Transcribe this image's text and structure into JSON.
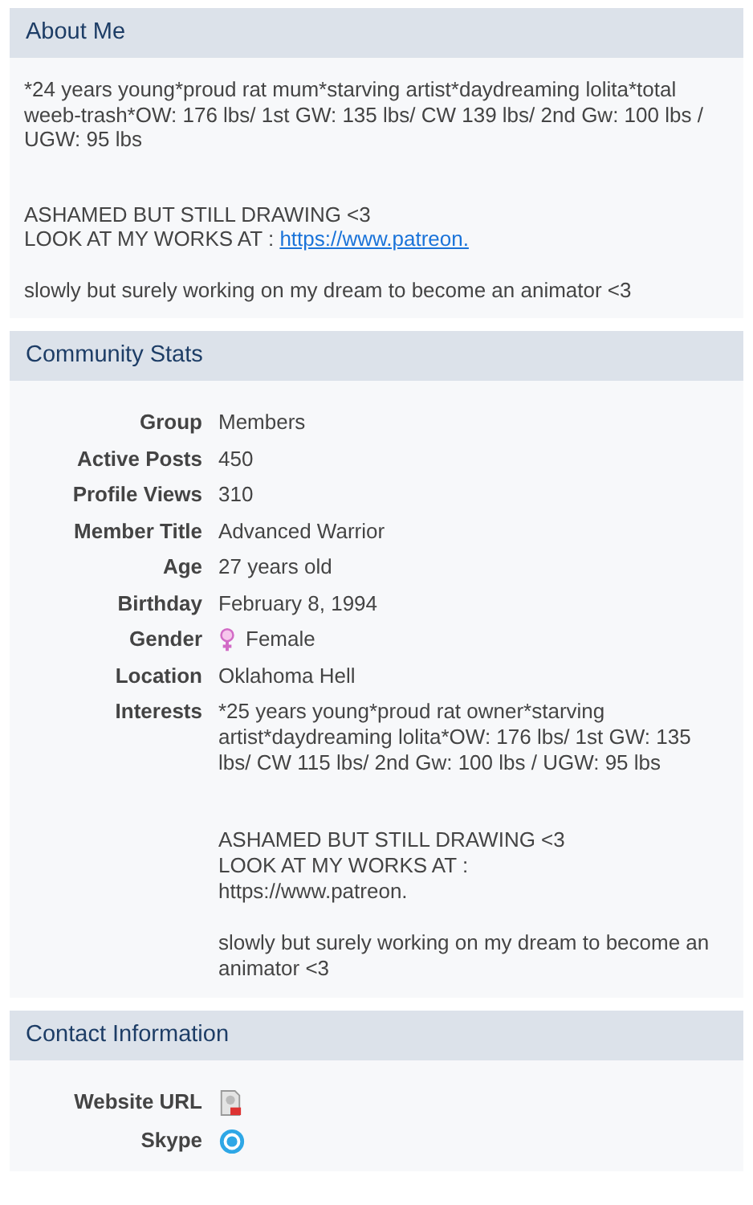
{
  "sections": [
    {
      "title": "About Me",
      "kind": "text",
      "paragraphs": [
        {
          "lines": [
            {
              "text": "*24 years young*proud rat mum*starving artist*daydreaming lolita*total weeb-trash*OW: 176 lbs/ 1st GW: 135 lbs/ CW 139 lbs/ 2nd Gw: 100 lbs / UGW: 95 lbs"
            }
          ]
        },
        {
          "lines": [
            {
              "text": "ASHAMED BUT STILL DRAWING <3"
            },
            {
              "text": "LOOK AT MY WORKS AT :",
              "link": "https://www.patreon."
            }
          ]
        },
        {
          "lines": [
            {
              "text": "slowly but surely working on my dream to become an animator <3"
            }
          ]
        }
      ]
    },
    {
      "title": "Community Stats",
      "kind": "fields",
      "fields": [
        {
          "label": "Group",
          "value": "Members"
        },
        {
          "label": "Active Posts",
          "value": "450"
        },
        {
          "label": "Profile Views",
          "value": "310"
        },
        {
          "label": "Member Title",
          "value": "Advanced Warrior"
        },
        {
          "label": "Age",
          "value": "27 years old"
        },
        {
          "label": "Birthday",
          "value": "February 8, 1994"
        },
        {
          "label": "Gender",
          "value": "Female"
        },
        {
          "label": "Location",
          "value": "Oklahoma Hell"
        },
        {
          "label": "Interests",
          "paragraphs": [
            "*25 years young*proud rat owner*starving artist*daydreaming lolita*OW: 176 lbs/ 1st GW: 135 lbs/ CW 115 lbs/ 2nd Gw: 100 lbs / UGW: 95 lbs",
            "ASHAMED BUT STILL DRAWING <3\nLOOK AT MY WORKS AT :\nhttps://www.patreon.",
            "slowly but surely working on my dream to become an animator <3"
          ]
        }
      ]
    },
    {
      "title": "Contact Information",
      "kind": "fields",
      "fields": [
        {
          "label": "Website URL"
        },
        {
          "label": "Skype"
        }
      ]
    }
  ]
}
